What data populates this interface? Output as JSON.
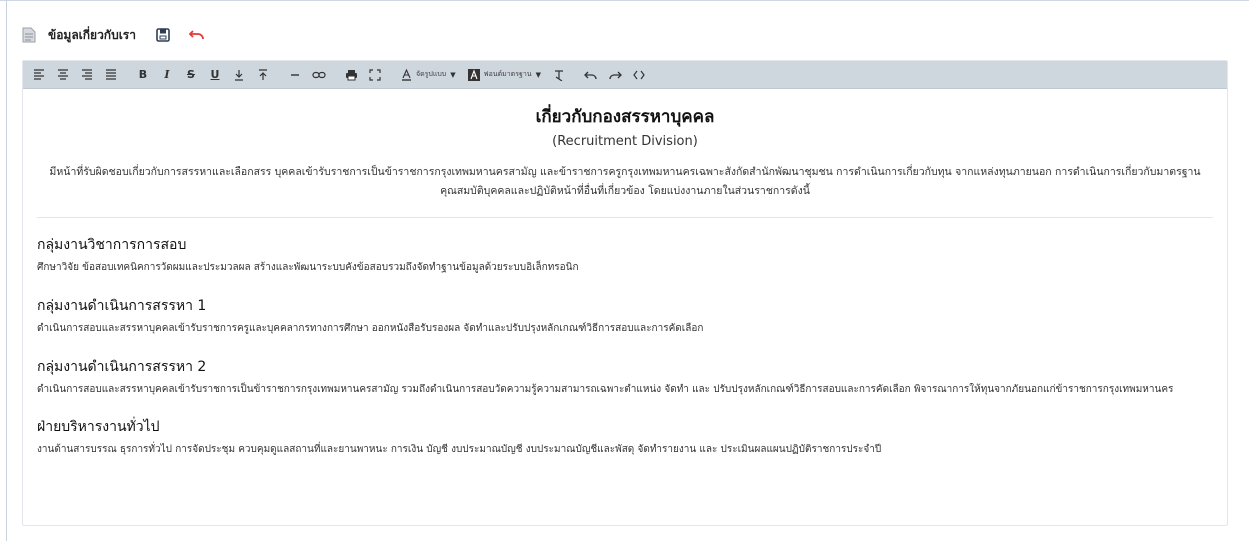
{
  "header": {
    "title": "ข้อมูลเกี่ยวกับเรา"
  },
  "toolbar": {
    "style_select": "จัดรูปแบบ",
    "font_select": "ฟอนต์มาตรฐาน",
    "icons": [
      "align-left",
      "align-center",
      "align-right",
      "align-justify",
      "bold",
      "italic",
      "strikethrough",
      "underline",
      "subscript",
      "superscript",
      "horizontal-rule",
      "link",
      "print",
      "fullscreen",
      "font-color",
      "background-color",
      "clear-format",
      "undo",
      "redo",
      "source-code"
    ]
  },
  "content": {
    "heading": "เกี่ยวกับกองสรรหาบุคคล",
    "subheading": "(Recruitment Division)",
    "intro": "มีหน้าที่รับผิดชอบเกี่ยวกับการสรรหาและเลือกสรร บุคคลเข้ารับราชการเป็นข้าราชการกรุงเทพมหานครสามัญ และข้าราชการครูกรุงเทพมหานครเฉพาะสังกัดสำนักพัฒนาชุมชน การดำเนินการเกี่ยวกับทุน จากแหล่งทุนภายนอก การดำเนินการเกี่ยวกับมาตรฐานคุณสมบัติบุคคลและปฏิบัติหน้าที่อื่นที่เกี่ยวข้อง โดยแบ่งงานภายในส่วนราชการดังนี้",
    "sections": [
      {
        "title": "กลุ่มงานวิชาการการสอบ",
        "body": "ศึกษาวิจัย ข้อสอบเทคนิคการวัดผมและประมวลผล สร้างและพัฒนาระบบคังข้อสอบรวมถึงจัดทำฐานข้อมูลด้วยระบบอิเล็กทรอนิก"
      },
      {
        "title": "กลุ่มงานดำเนินการสรรหา 1",
        "body": "ดำเนินการสอบและสรรหาบุคคลเข้ารับราชการครูและบุคคลากรทางการศึกษา ออกหนังสือรับรองผล จัดทำและปรับปรุงหลักเกณฑ์วิธีการสอบและการคัดเลือก"
      },
      {
        "title": "กลุ่มงานดำเนินการสรรหา 2",
        "body": "ดำเนินการสอบและสรรหาบุคคลเข้ารับราชการเป็นข้าราชการกรุงเทพมหานครสามัญ รวมถึงดำเนินการสอบวัดความรู้ความสามารถเฉพาะตำแหน่ง จัดทำ และ        ปรับปรุงหลักเกณฑ์วิธีการสอบและการคัดเลือก พิจารณาการให้ทุนจากภัยนอกแก่ข้าราชการกรุงเทพมหานคร"
      },
      {
        "title": "ฝ่ายบริหารงานทั่วไป",
        "body": "งานด้านสารบรรณ ธุรการทั่วไป การจัดประชุม ควบคุมดูแลสถานที่และยานพาหนะ การเงิน บัญชี งบประมาณบัญชี งบประมาณบัญชีและพัสดุ จัดทำรายงาน และ    ประเมินผลแผนปฏิบัติราชการประจำปี"
      }
    ]
  },
  "colors": {
    "toolbar_bg": "#ced6de",
    "undo_icon": "#e53935",
    "save_icon": "#2e3d55",
    "border": "#e3e6ea"
  }
}
